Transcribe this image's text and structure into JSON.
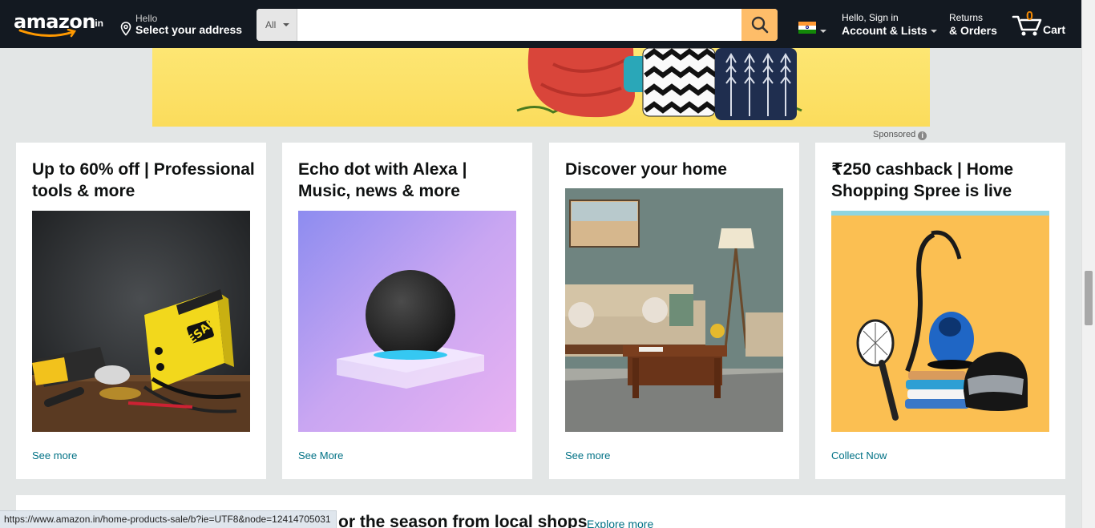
{
  "header": {
    "logo_text": "amazon",
    "logo_tld": ".in",
    "address_greeting": "Hello",
    "address_action": "Select your address",
    "search_category": "All",
    "search_placeholder": "",
    "account_greeting": "Hello, Sign in",
    "account_label": "Account & Lists",
    "returns_line1": "Returns",
    "returns_line2": "& Orders",
    "cart_count": "0",
    "cart_label": "Cart"
  },
  "banner": {
    "sponsored_label": "Sponsored",
    "info_icon": "i"
  },
  "cards": [
    {
      "title": "Up to 60% off | Professional tools & more",
      "link": "See more",
      "image": "power-tools-image"
    },
    {
      "title": "Echo dot with Alexa | Music, news & more",
      "link": "See More",
      "image": "echo-dot-image"
    },
    {
      "title": "Discover your home",
      "link": "See more",
      "image": "living-room-image"
    },
    {
      "title": "₹250 cashback | Home Shopping Spree is live",
      "link": "Collect Now",
      "image": "home-appliances-image"
    }
  ],
  "strip": {
    "title": "or the season from local shops",
    "explore_link": "Explore more"
  },
  "status_url": "https://www.amazon.in/home-products-sale/b?ie=UTF8&node=12414705031",
  "colors": {
    "nav_bg": "#131921",
    "search_button": "#febd69",
    "link": "#007185",
    "cart_count": "#f08804"
  }
}
